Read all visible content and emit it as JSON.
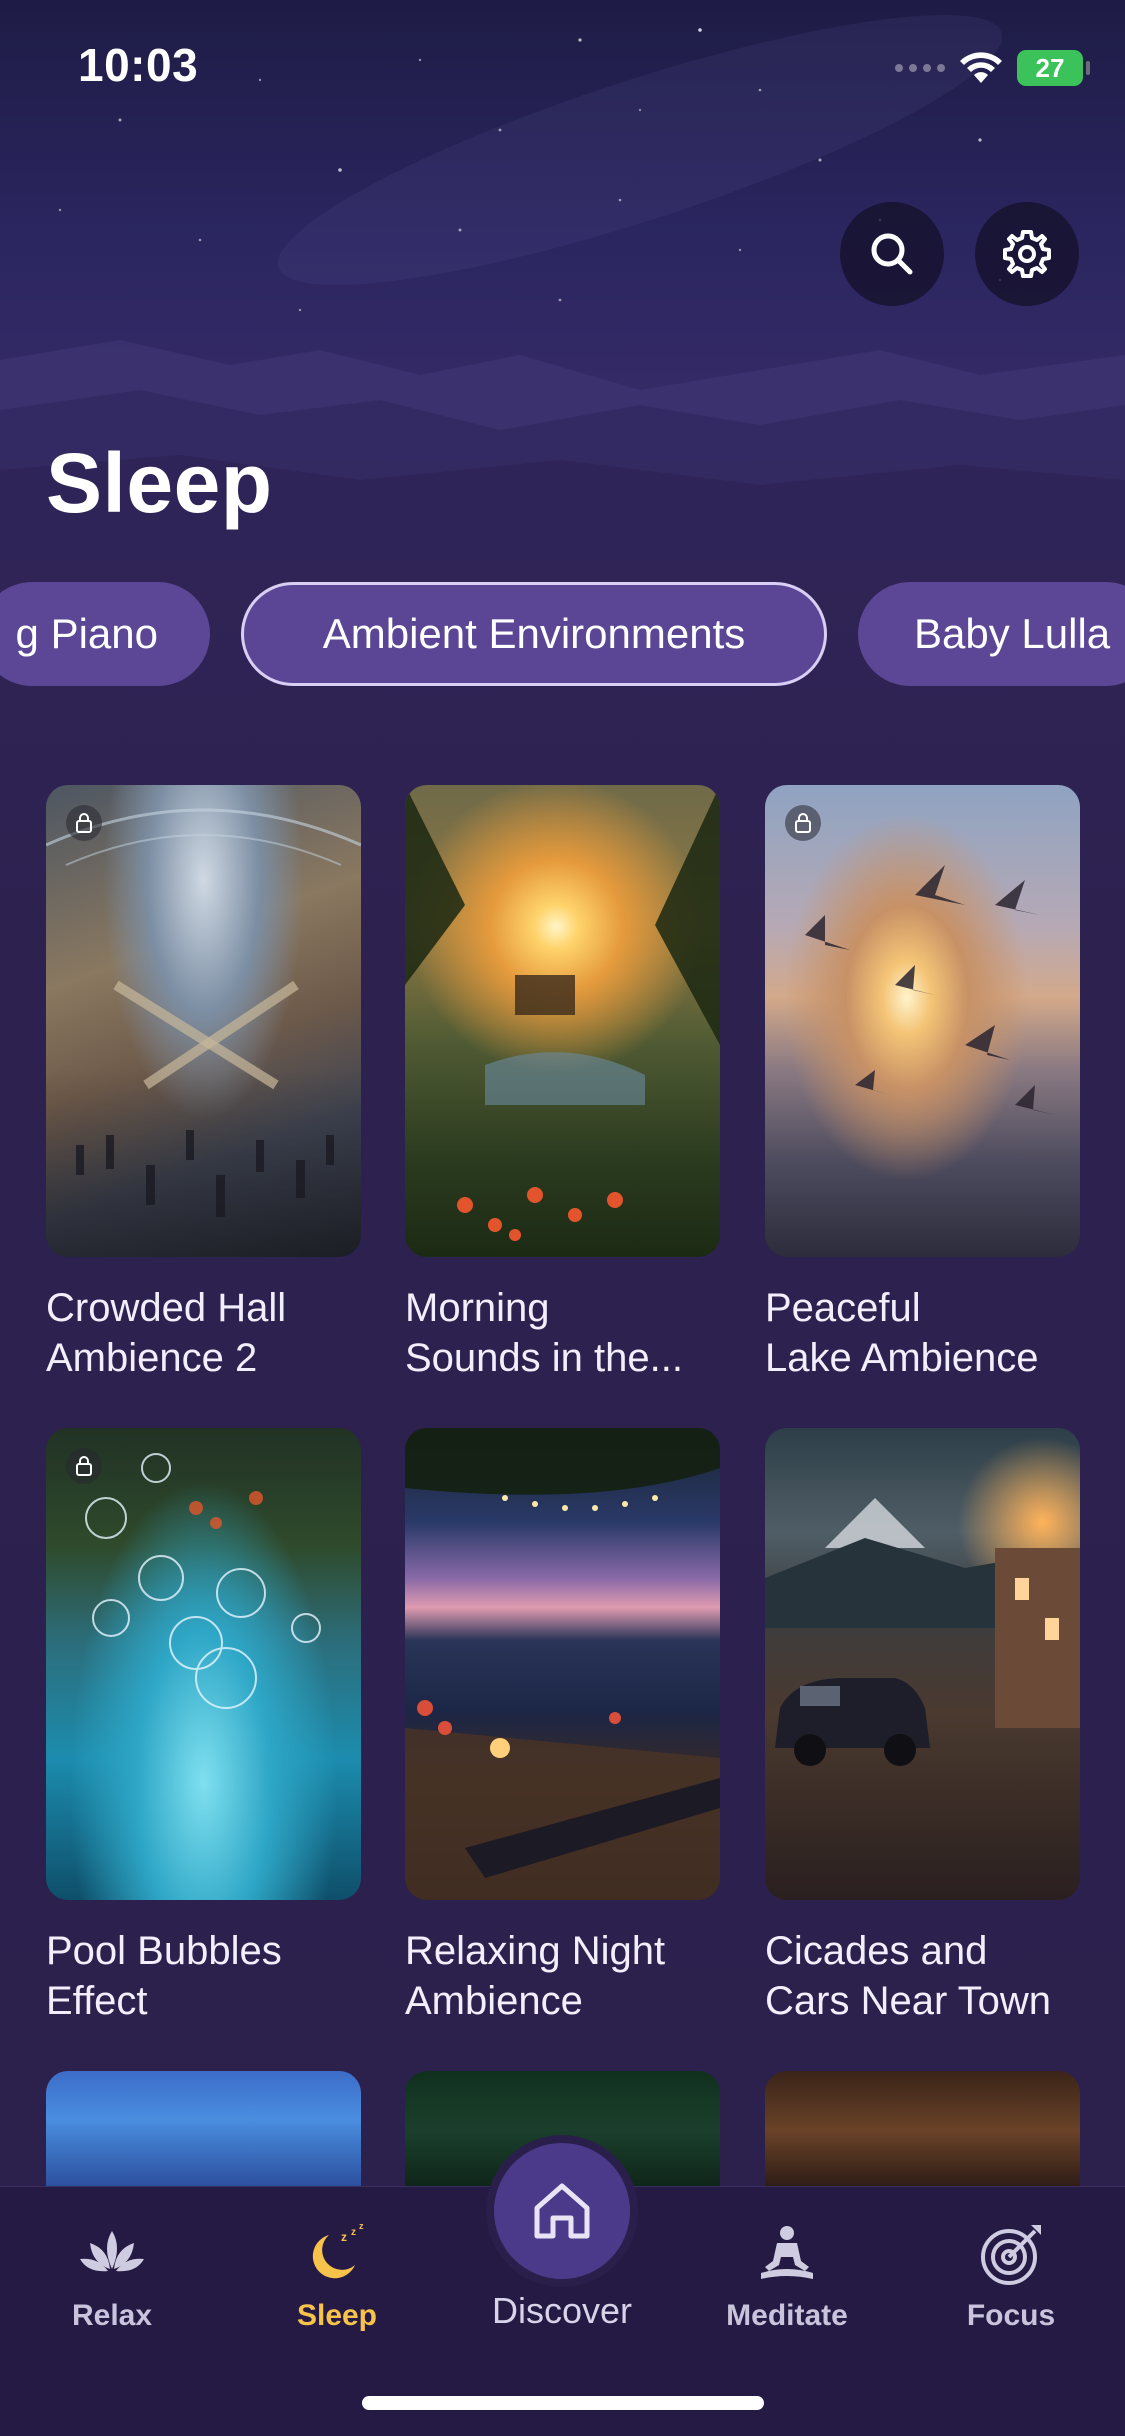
{
  "status_bar": {
    "time": "10:03",
    "battery": "27"
  },
  "header": {
    "title": "Sleep"
  },
  "categories": [
    {
      "label": "g Piano",
      "active": false
    },
    {
      "label": "Ambient Environments",
      "active": true
    },
    {
      "label": "Baby Lulla",
      "active": false
    }
  ],
  "cards": [
    {
      "title": "Crowded Hall Ambience 2",
      "locked": true
    },
    {
      "title": "Morning Sounds in the...",
      "locked": false
    },
    {
      "title": "Peaceful Lake Ambience",
      "locked": true
    },
    {
      "title": "Pool Bubbles Effect",
      "locked": true
    },
    {
      "title": "Relaxing Night Ambience",
      "locked": false
    },
    {
      "title": "Cicades and Cars Near Town",
      "locked": false
    }
  ],
  "card_titles": [
    [
      "Crowded Hall",
      "Ambience 2"
    ],
    [
      "Morning",
      "Sounds in the..."
    ],
    [
      "Peaceful",
      "Lake Ambience"
    ],
    [
      "Pool Bubbles",
      "Effect"
    ],
    [
      "Relaxing Night",
      "Ambience"
    ],
    [
      "Cicades and",
      "Cars Near Town"
    ]
  ],
  "bottom_nav": {
    "relax": "Relax",
    "sleep": "Sleep",
    "discover": "Discover",
    "meditate": "Meditate",
    "focus": "Focus",
    "active": "Sleep"
  },
  "colors": {
    "accent_active_tab": "#f7c34a",
    "pill_bg": "#5b4795",
    "background": "#2c204c"
  }
}
